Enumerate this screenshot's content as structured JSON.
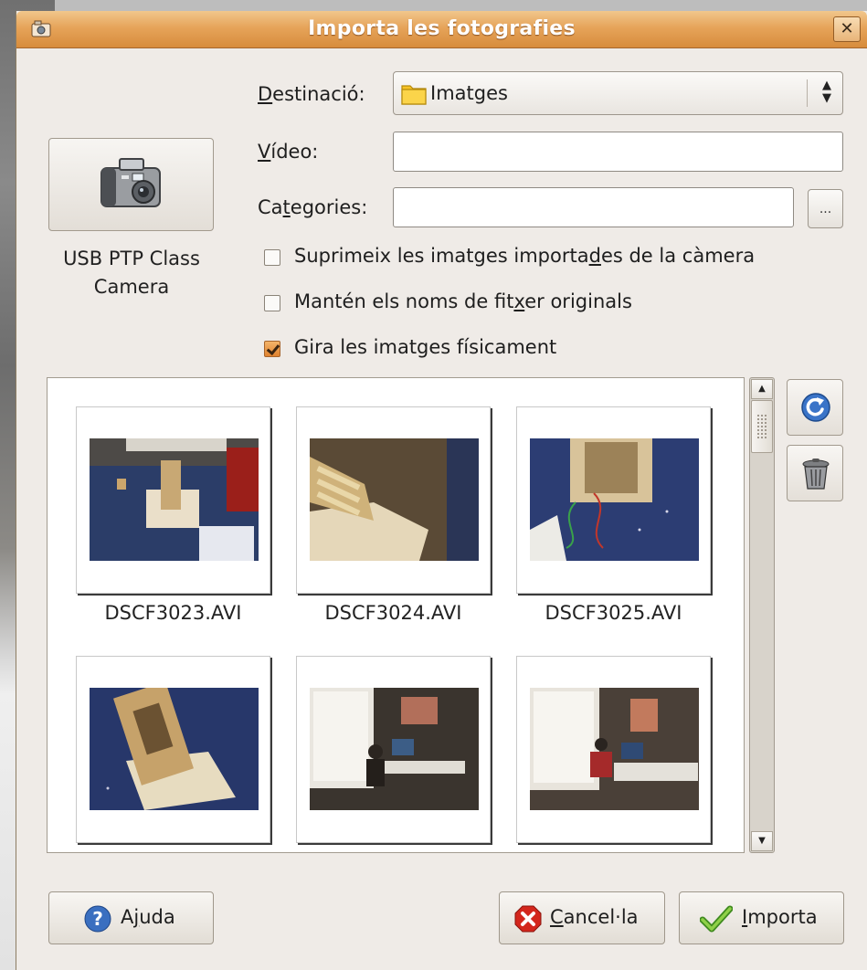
{
  "window": {
    "title": "Importa les fotografies",
    "close_glyph": "✕"
  },
  "camera": {
    "label": "USB PTP Class Camera",
    "icon": "camera-icon"
  },
  "form": {
    "destination_label_mnemonic": "D",
    "destination_label_rest": "estinació:",
    "destination_value": "Imatges",
    "video_label_mnemonic": "V",
    "video_label_rest": "ídeo:",
    "video_value": "",
    "categories_label_pre": "Ca",
    "categories_label_mnemonic": "t",
    "categories_label_post": "egories:",
    "categories_value": "",
    "browse_label": "..."
  },
  "options": [
    {
      "pre": "Suprimeix les imatges importa",
      "mnemonic": "d",
      "post": "es de la càmera",
      "checked": false
    },
    {
      "pre": "Mantén els noms de fit",
      "mnemonic": "x",
      "post": "er originals",
      "checked": false
    },
    {
      "pre": "Gira les imatges físicament",
      "mnemonic": "",
      "post": "",
      "checked": true
    }
  ],
  "thumbnails": [
    {
      "name": "DSCF3023.AVI"
    },
    {
      "name": "DSCF3024.AVI"
    },
    {
      "name": "DSCF3025.AVI"
    },
    {
      "name": ""
    },
    {
      "name": ""
    },
    {
      "name": ""
    }
  ],
  "side_buttons": {
    "rotate": "rotate-icon",
    "delete": "trash-icon"
  },
  "buttons": {
    "help_pre": "A",
    "help_mnemonic": "j",
    "help_post": "uda",
    "cancel_mnemonic": "C",
    "cancel_post": "ancel·la",
    "import_mnemonic": "I",
    "import_post": "mporta"
  },
  "colors": {
    "titlebar": "#e0973f",
    "dialog_bg": "#efebe7"
  }
}
